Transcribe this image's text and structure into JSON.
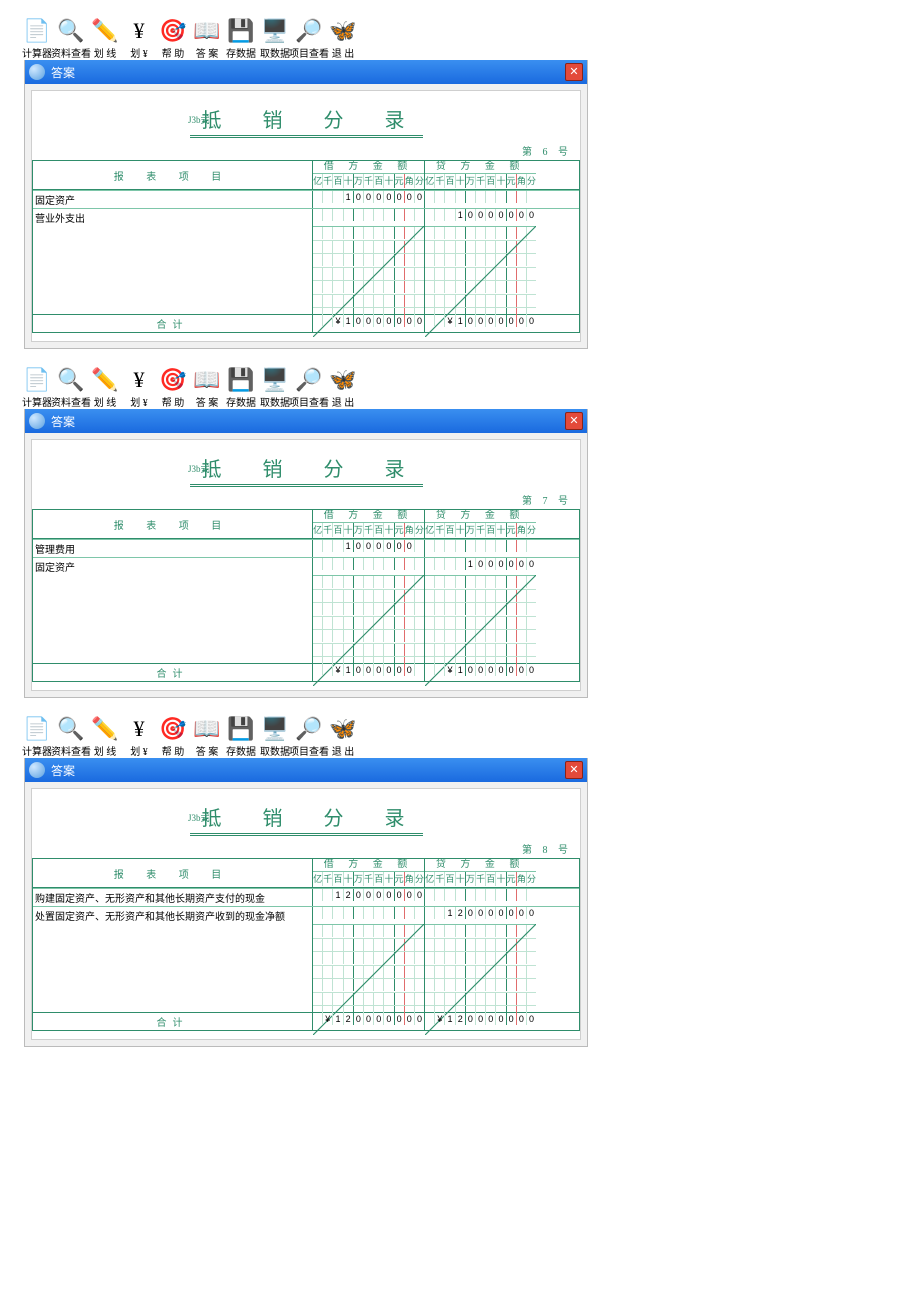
{
  "toolbar": [
    {
      "icon": "📄",
      "label": "计算器"
    },
    {
      "icon": "🔍",
      "label": "资料查看"
    },
    {
      "icon": "✏️",
      "label": "划 线"
    },
    {
      "icon": "¥",
      "label": "划 ¥"
    },
    {
      "icon": "🎯",
      "label": "帮 助"
    },
    {
      "icon": "📖",
      "label": "答 案"
    },
    {
      "icon": "💾",
      "label": "存数据"
    },
    {
      "icon": "🖥️",
      "label": "取数据"
    },
    {
      "icon": "🔎",
      "label": "项目查看"
    },
    {
      "icon": "🦋",
      "label": "退 出"
    }
  ],
  "window_title": "答案",
  "form_code": "J3b式",
  "doc_title": "抵 销 分 录",
  "headers": {
    "item": "报 表 项 目",
    "debit": "借 方 金 额",
    "credit": "贷 方 金 额"
  },
  "digits": [
    "亿",
    "千",
    "百",
    "十",
    "万",
    "千",
    "百",
    "十",
    "元",
    "角",
    "分"
  ],
  "total_label": "合计",
  "page_prefix": "第",
  "page_suffix": "号",
  "vouchers": [
    {
      "page": "6",
      "rows": [
        {
          "item": "固定资产",
          "debit": [
            "",
            "",
            "",
            "1",
            "0",
            "0",
            "0",
            "0",
            "0",
            "0",
            "0"
          ],
          "credit": [
            "",
            "",
            "",
            "",
            "",
            "",
            "",
            "",
            "",
            "",
            ""
          ]
        },
        {
          "item": "营业外支出",
          "debit": [
            "",
            "",
            "",
            "",
            "",
            "",
            "",
            "",
            "",
            "",
            ""
          ],
          "credit": [
            "",
            "",
            "",
            "1",
            "0",
            "0",
            "0",
            "0",
            "0",
            "0",
            "0"
          ]
        }
      ],
      "total": {
        "debit": [
          "",
          "",
          "¥",
          "1",
          "0",
          "0",
          "0",
          "0",
          "0",
          "0",
          "0"
        ],
        "credit": [
          "",
          "",
          "¥",
          "1",
          "0",
          "0",
          "0",
          "0",
          "0",
          "0",
          "0"
        ]
      }
    },
    {
      "page": "7",
      "rows": [
        {
          "item": "管理费用",
          "debit": [
            "",
            "",
            "",
            "1",
            "0",
            "0",
            "0",
            "0",
            "0",
            "0",
            ""
          ],
          "credit": [
            "",
            "",
            "",
            "",
            "",
            "",
            "",
            "",
            "",
            "",
            ""
          ]
        },
        {
          "item": "固定资产",
          "debit": [
            "",
            "",
            "",
            "",
            "",
            "",
            "",
            "",
            "",
            "",
            ""
          ],
          "credit": [
            "",
            "",
            "",
            "",
            "1",
            "0",
            "0",
            "0",
            "0",
            "0",
            "0"
          ]
        }
      ],
      "total": {
        "debit": [
          "",
          "",
          "¥",
          "1",
          "0",
          "0",
          "0",
          "0",
          "0",
          "0",
          ""
        ],
        "credit": [
          "",
          "",
          "¥",
          "1",
          "0",
          "0",
          "0",
          "0",
          "0",
          "0",
          "0"
        ]
      }
    },
    {
      "page": "8",
      "rows": [
        {
          "item": "购建固定资产、无形资产和其他长期资产支付的现金",
          "debit": [
            "",
            "",
            "1",
            "2",
            "0",
            "0",
            "0",
            "0",
            "0",
            "0",
            "0"
          ],
          "credit": [
            "",
            "",
            "",
            "",
            "",
            "",
            "",
            "",
            "",
            "",
            ""
          ]
        },
        {
          "item": "处置固定资产、无形资产和其他长期资产收到的现金净额",
          "debit": [
            "",
            "",
            "",
            "",
            "",
            "",
            "",
            "",
            "",
            "",
            ""
          ],
          "credit": [
            "",
            "",
            "1",
            "2",
            "0",
            "0",
            "0",
            "0",
            "0",
            "0",
            "0"
          ]
        }
      ],
      "total": {
        "debit": [
          "",
          "¥",
          "1",
          "2",
          "0",
          "0",
          "0",
          "0",
          "0",
          "0",
          "0"
        ],
        "credit": [
          "",
          "¥",
          "1",
          "2",
          "0",
          "0",
          "0",
          "0",
          "0",
          "0",
          "0"
        ]
      }
    }
  ]
}
